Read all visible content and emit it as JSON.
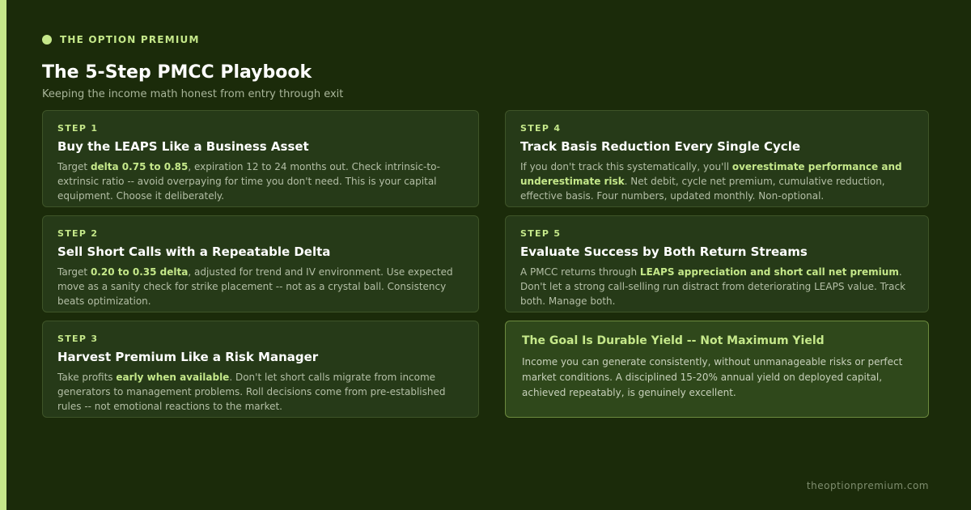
{
  "brand": {
    "name": "THE OPTION PREMIUM",
    "accent_color": "#c5e88a",
    "background_color": "#1b2b0a"
  },
  "header": {
    "title": "The 5-Step PMCC Playbook",
    "subtitle": "Keeping the income math honest from entry through exit"
  },
  "steps": [
    {
      "step_label": "STEP 1",
      "title": "Buy the LEAPS Like a Business Asset",
      "body_pre": "Target ",
      "body_highlight": "delta 0.75 to 0.85",
      "body_post": ", expiration 12 to 24 months out. Check intrinsic-to-extrinsic ratio -- avoid overpaying for time you don't need. This is your capital equipment. Choose it deliberately."
    },
    {
      "step_label": "STEP 2",
      "title": "Sell Short Calls with a Repeatable Delta",
      "body_pre": "Target ",
      "body_highlight": "0.20 to 0.35 delta",
      "body_post": ", adjusted for trend and IV environment. Use expected move as a sanity check for strike placement -- not as a crystal ball. Consistency beats optimization."
    },
    {
      "step_label": "STEP 3",
      "title": "Harvest Premium Like a Risk Manager",
      "body_pre": "Take profits ",
      "body_highlight": "early when available",
      "body_post": ". Don't let short calls migrate from income generators to management problems. Roll decisions come from pre-established rules -- not emotional reactions to the market."
    },
    {
      "step_label": "STEP 4",
      "title": "Track Basis Reduction Every Single Cycle",
      "body_pre": "If you don't track this systematically, you'll ",
      "body_highlight": "overestimate performance and underestimate risk",
      "body_post": ". Net debit, cycle net premium, cumulative reduction, effective basis. Four numbers, updated monthly. Non-optional."
    },
    {
      "step_label": "STEP 5",
      "title": "Evaluate Success by Both Return Streams",
      "body_pre": "A PMCC returns through ",
      "body_highlight": "LEAPS appreciation and short call net premium",
      "body_post": ". Don't let a strong call-selling run distract from deteriorating LEAPS value. Track both. Manage both."
    }
  ],
  "goal": {
    "title": "The Goal Is Durable Yield -- Not Maximum Yield",
    "body": "Income you can generate consistently, without unmanageable risks or perfect market conditions. A disciplined 15-20% annual yield on deployed capital, achieved repeatably, is genuinely excellent."
  },
  "footer": {
    "url": "theoptionpremium.com"
  }
}
